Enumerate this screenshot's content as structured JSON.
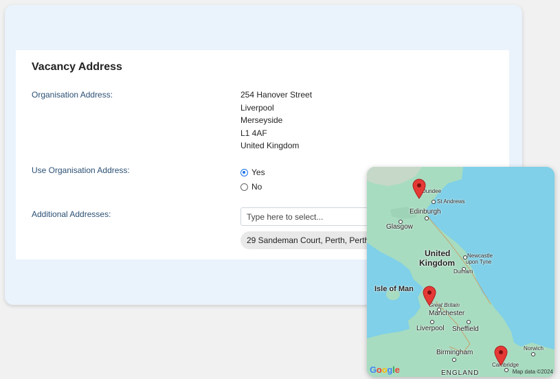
{
  "section": {
    "title": "Vacancy Address"
  },
  "org_address": {
    "label": "Organisation Address:",
    "lines": [
      "254 Hanover Street",
      "Liverpool",
      "Merseyside",
      "L1 4AF",
      "United Kingdom"
    ]
  },
  "use_org": {
    "label": "Use Organisation Address:",
    "options": [
      {
        "label": "Yes",
        "selected": true
      },
      {
        "label": "No",
        "selected": false
      }
    ]
  },
  "additional": {
    "label": "Additional Addresses:",
    "placeholder": "Type here to select...",
    "selected_chip": "29 Sandeman Court, Perth, Perth"
  },
  "map": {
    "labels": {
      "dundee": "Dundee",
      "st_andrews": "St Andrews",
      "edinburgh": "Edinburgh",
      "glasgow": "Glasgow",
      "united": "United",
      "kingdom": "Kingdom",
      "newcastle": "Newcastle",
      "upon_tyne": "upon Tyne",
      "durham": "Durham",
      "isle_of_man": "Isle of Man",
      "great_britain": "Great Britain",
      "manchester": "Manchester",
      "liverpool": "Liverpool",
      "sheffield": "Sheffield",
      "birmingham": "Birmingham",
      "norwich": "Norwich",
      "cambridge": "Cambridge",
      "england": "ENGLAND"
    },
    "attribution": "Map data ©2024",
    "logo": "Google",
    "colors": {
      "sea": "#7fd0e8",
      "land": "#a8dcc0",
      "pin": "#e53935"
    }
  }
}
